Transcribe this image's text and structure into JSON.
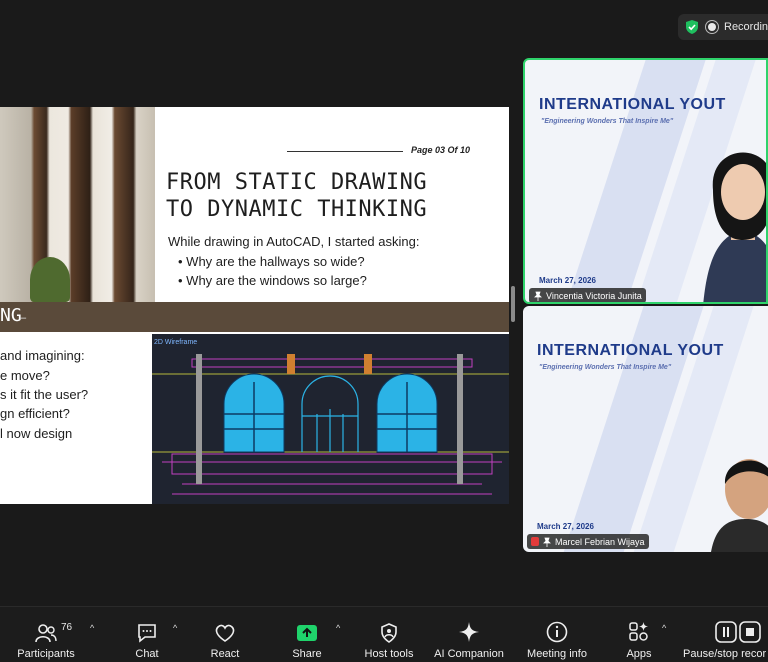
{
  "recording": {
    "label": "Recording"
  },
  "slide": {
    "page_label": "Page 03 Of 10",
    "title_line1": "FROM STATIC DRAWING",
    "title_line2": "TO DYNAMIC THINKING",
    "intro": "While drawing in AutoCAD, I started asking:",
    "bullets": [
      "Why are the hallways so wide?",
      "Why are the windows so large?"
    ],
    "band_text": "NG",
    "band_dash": "–",
    "questions": [
      "and imagining:",
      "e move?",
      "s it fit the user?",
      "gn efficient?",
      "l now design"
    ],
    "cad_label": "2D Wireframe"
  },
  "participants_tiles": [
    {
      "org_title": "INTERNATIONAL YOUT",
      "tagline": "\"Engineering Wonders That Inspire Me\"",
      "date": "March 27, 2026",
      "name": "Vincentia Victoria Junita",
      "active_speaker": true
    },
    {
      "org_title": "INTERNATIONAL YOUT",
      "tagline": "\"Engineering Wonders That Inspire Me\"",
      "date": "March 27, 2026",
      "name": "Marcel Febrian Wijaya",
      "active_speaker": false,
      "muted": true
    }
  ],
  "toolbar": {
    "participants_label": "Participants",
    "participants_count": "76",
    "chat_label": "Chat",
    "react_label": "React",
    "share_label": "Share",
    "host_tools_label": "Host tools",
    "ai_label": "AI Companion",
    "meeting_info_label": "Meeting info",
    "apps_label": "Apps",
    "pause_label": "Pause/stop recor"
  },
  "colors": {
    "share_green": "#1fd36b",
    "active_border": "#2fd36b",
    "brand_blue": "#1f3b8a"
  }
}
